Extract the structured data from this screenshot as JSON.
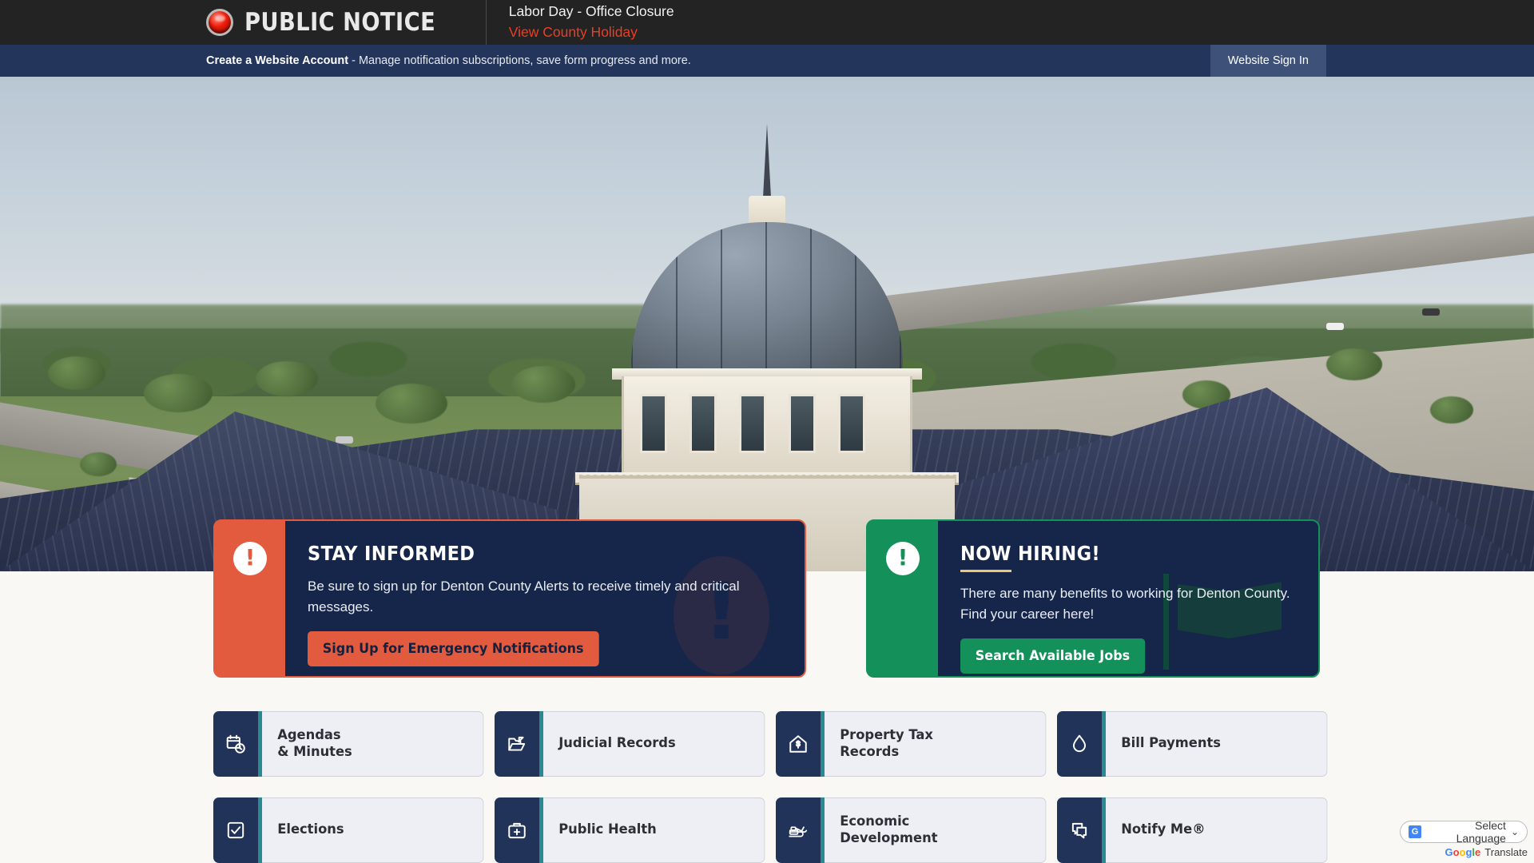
{
  "notice_bar": {
    "icon": "siren-icon",
    "title": "PUBLIC NOTICE",
    "message_title": "Labor Day - Office Closure",
    "message_link": "View County Holiday"
  },
  "account_bar": {
    "link_label": "Create a Website Account",
    "description": " - Manage notification subscriptions, save form progress and more.",
    "signin_label": "Website Sign In"
  },
  "hero": {
    "alt": "Aerial view of Denton County courthouse dome and surrounding grounds"
  },
  "promos": [
    {
      "id": "stay-informed",
      "heading": "STAY INFORMED",
      "text": "Be sure to sign up for Denton County Alerts to receive timely and critical messages.",
      "button": "Sign Up for Emergency Notifications",
      "accent": "#e35b3e",
      "watermark": "exclamation-watermark"
    },
    {
      "id": "now-hiring",
      "heading": "NOW HIRING!",
      "text": "There are many benefits to working for Denton County. Find your career here!",
      "button": "Search Available Jobs",
      "accent": "#14915b",
      "rule_color": "#f0c76a",
      "watermark": "flag-watermark"
    }
  ],
  "quick_links": [
    {
      "label": "Agendas\n& Minutes",
      "icon": "calendar-clock-icon"
    },
    {
      "label": "Judicial Records",
      "icon": "folder-open-arrow-icon"
    },
    {
      "label": "Property Tax\nRecords",
      "icon": "house-dollar-icon"
    },
    {
      "label": "Bill Payments",
      "icon": "water-drop-icon"
    },
    {
      "label": "Elections",
      "icon": "checkbox-check-icon"
    },
    {
      "label": "Public Health",
      "icon": "medical-kit-icon"
    },
    {
      "label": "Economic\nDevelopment",
      "icon": "excavator-icon"
    },
    {
      "label": "Notify Me®",
      "icon": "speech-bubbles-icon"
    }
  ],
  "translate": {
    "selected": "Select Language",
    "caret": "⌄",
    "brand_g1": "G",
    "brand_g2": "o",
    "brand_g3": "o",
    "brand_g4": "g",
    "brand_g5": "l",
    "brand_g6": "e",
    "brand_word": "Translate"
  },
  "colors": {
    "navy": "#22335a",
    "deep_navy": "#16254a",
    "teal": "#2a8a92",
    "orange": "#e35b3e",
    "green": "#14915b",
    "gold": "#f0c76a",
    "page_bg": "#faf8f4"
  }
}
